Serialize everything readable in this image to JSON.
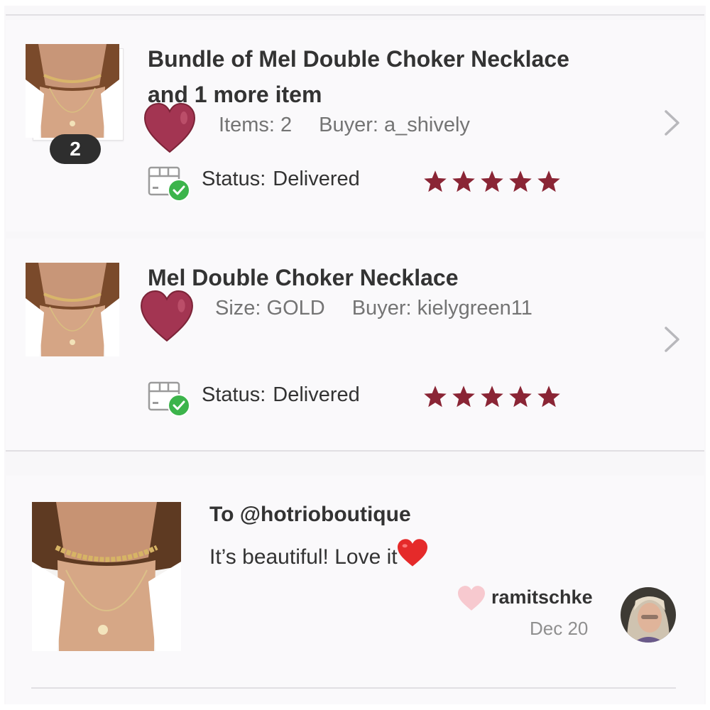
{
  "orders": [
    {
      "title_line1": "Bundle of Mel Double Choker Necklace",
      "title_line2": "and 1 more item",
      "meta1": "Items: 2",
      "meta2": "Buyer: a_shively",
      "badge_count": "2",
      "status_label": "Status:",
      "status_value": "Delivered",
      "rating": 5,
      "max_rating": 5
    },
    {
      "title_line1": "Mel Double Choker Necklace",
      "meta1": "Size: GOLD",
      "meta2": "Buyer: kielygreen11",
      "status_label": "Status:",
      "status_value": "Delivered",
      "rating": 5,
      "max_rating": 5
    }
  ],
  "comment": {
    "to": "To @hotrioboutique",
    "body": "It’s beautiful! Love it",
    "emoji": "❤️",
    "author": "ramitschke",
    "date": "Dec 20"
  },
  "colors": {
    "star": "#8a2535",
    "heart_overlay": "#a33552",
    "check_green": "#3cb44b",
    "like_heart": "#f7c9cf",
    "chevron": "#b8b8bc"
  },
  "icons": {
    "chevron": "chevron-right-icon",
    "delivered": "delivered-box-icon",
    "star": "star-icon",
    "like": "heart-icon"
  }
}
